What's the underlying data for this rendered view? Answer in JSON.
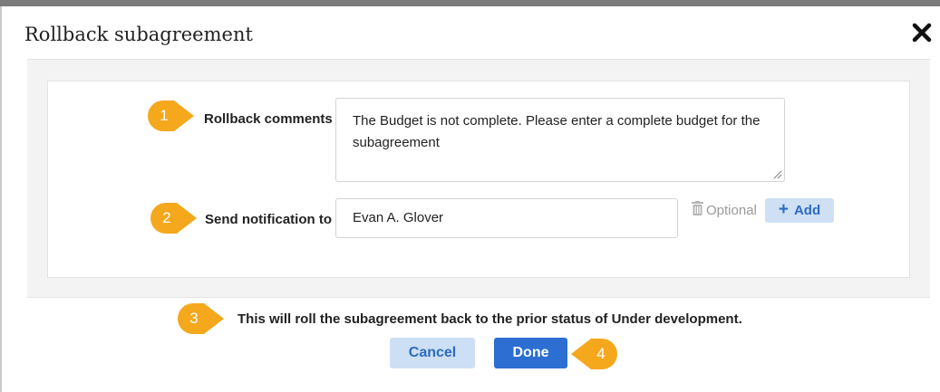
{
  "dialog": {
    "title": "Rollback subagreement",
    "close_icon": "close-x-icon"
  },
  "form": {
    "rollback_comments": {
      "label": "Rollback comments",
      "value": "The Budget is not complete. Please enter a complete budget for the subagreement"
    },
    "send_notification": {
      "label": "Send notification to",
      "value": "Evan A. Glover",
      "optional_label": "Optional",
      "remove_icon": "trash-icon",
      "add_label": "Add",
      "add_icon": "plus-icon"
    }
  },
  "message": "This will roll the subagreement back to the prior status of Under development.",
  "actions": {
    "cancel_label": "Cancel",
    "done_label": "Done"
  },
  "callouts": [
    "1",
    "2",
    "3",
    "4"
  ],
  "colors": {
    "callout": "#f5a81c",
    "primary": "#2c6ed2",
    "secondary_bg": "#cddff4"
  }
}
